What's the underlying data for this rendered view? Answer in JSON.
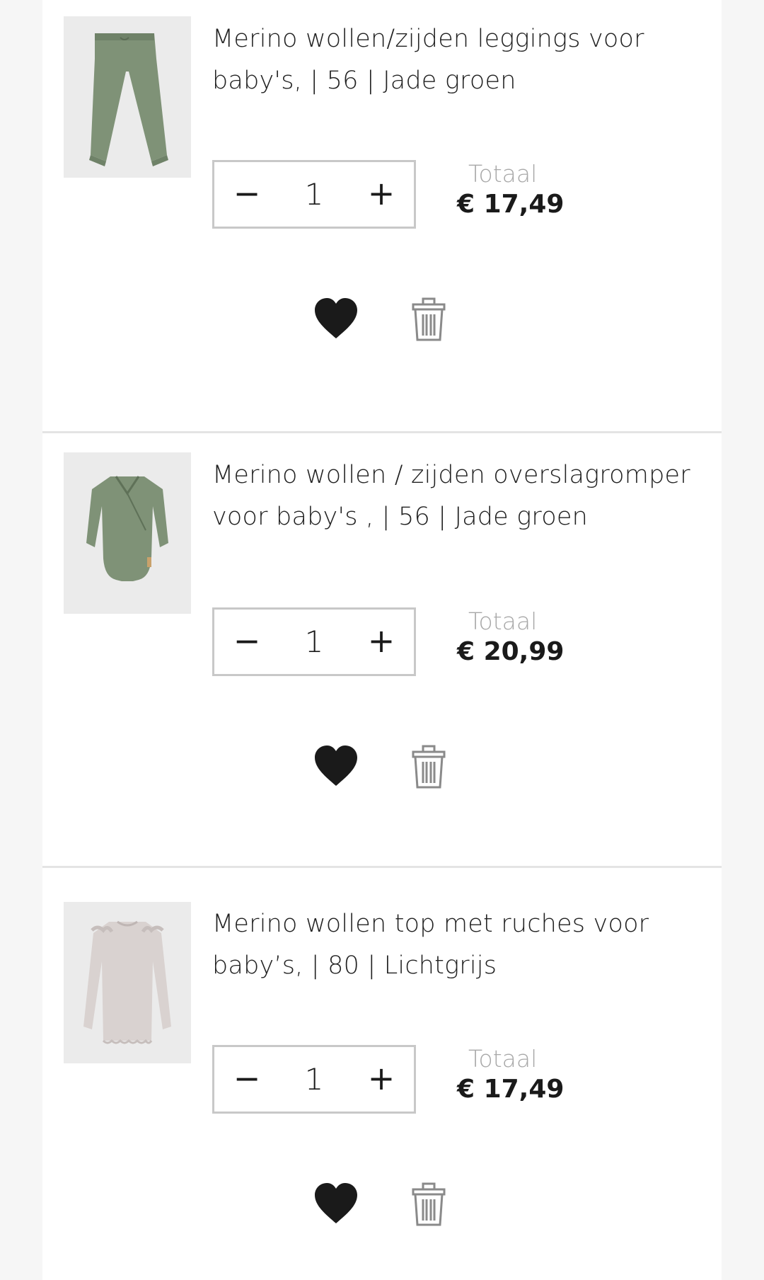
{
  "cart": {
    "items": [
      {
        "title": "Merino wollen/zijden leggings voor baby's, | 56 | Jade groen",
        "quantity": "1",
        "total_label": "Totaal",
        "total_price": "€ 17,49",
        "image": "green-leggings"
      },
      {
        "title": "Merino wollen / zijden overslagromper voor baby's , | 56 | Jade groen",
        "quantity": "1",
        "total_label": "Totaal",
        "total_price": "€ 20,99",
        "image": "green-wrap-romper"
      },
      {
        "title": "Merino wollen top met ruches voor baby’s, | 80 | Lichtgrijs",
        "quantity": "1",
        "total_label": "Totaal",
        "total_price": "€ 17,49",
        "image": "light-grey-ruffle-top"
      }
    ],
    "controls": {
      "minus_symbol": "−",
      "plus_symbol": "+"
    },
    "icons": {
      "favorite": "heart-icon",
      "delete": "trash-icon"
    }
  },
  "colors": {
    "background": "#f6f6f6",
    "panel": "#ffffff",
    "divider": "#e4e4e4",
    "label_grey": "#a8a8a8",
    "text": "#1a1a1a",
    "jade_green": "#7f9277",
    "light_grey_garment": "#d9d2d0"
  }
}
